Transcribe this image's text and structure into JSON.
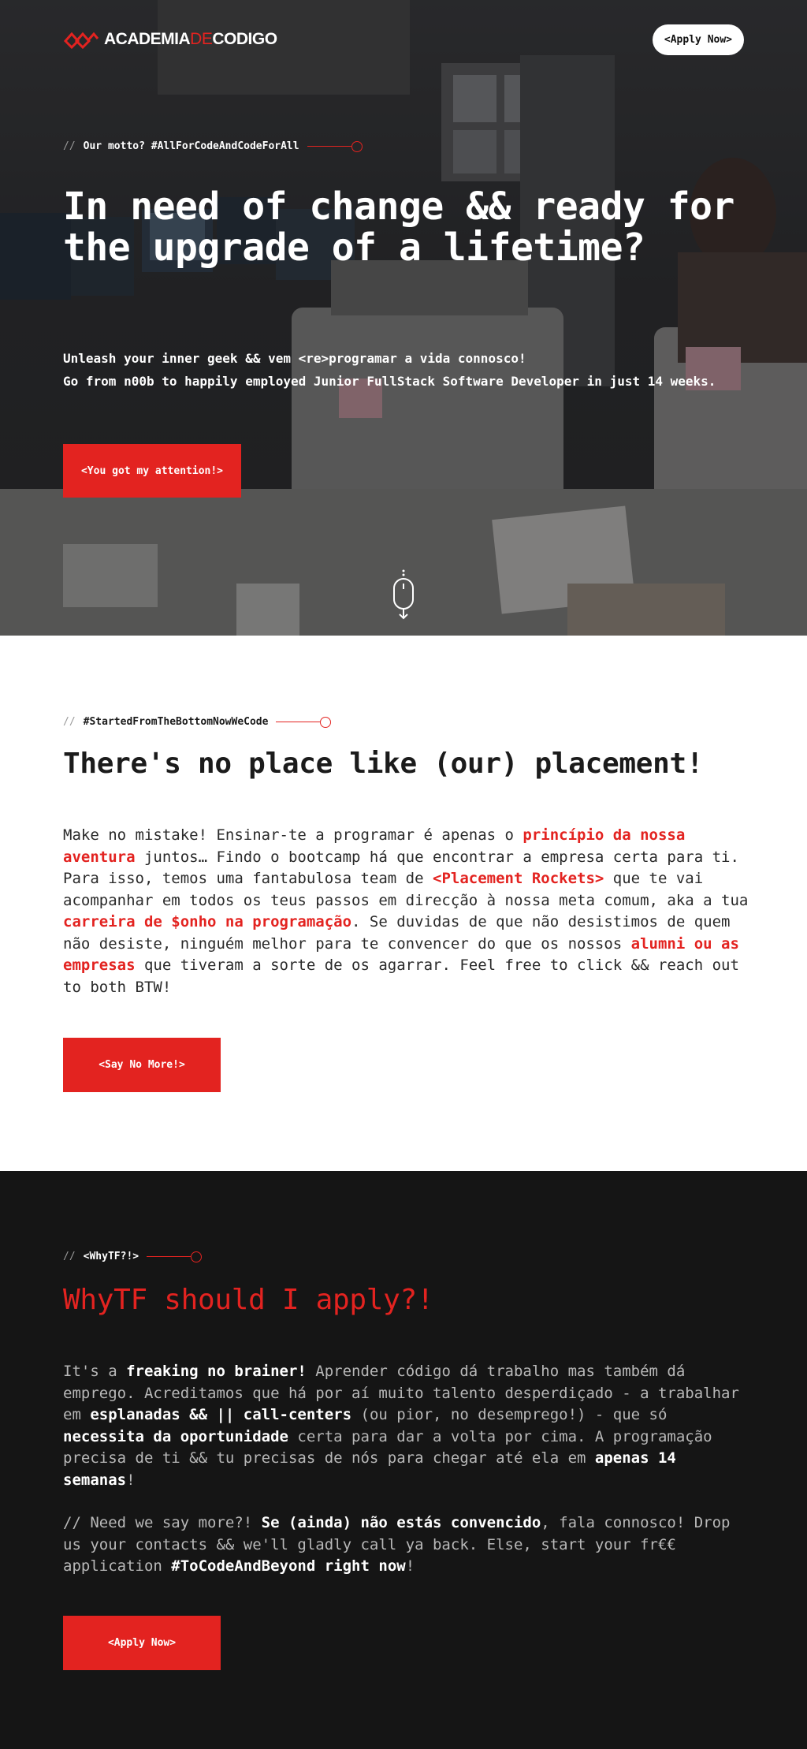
{
  "header": {
    "logo_main": "ACADEMIA",
    "logo_de": "DE",
    "logo_end": "CODIGO",
    "apply_label": "<Apply Now>"
  },
  "hero": {
    "eyebrow_slashes": "//",
    "eyebrow_text": "Our motto? #AllForCodeAndCodeForAll",
    "title": "In need of change && ready for the upgrade of a lifetime?",
    "sub_line1": "Unleash your inner geek && vem <re>programar a vida connosco!",
    "sub_line2": "Go from n00b to happily employed Junior FullStack Software Developer in just 14 weeks.",
    "cta_label": "<You got my attention!>"
  },
  "placement": {
    "eyebrow_slashes": "//",
    "eyebrow_text": "#StartedFromTheBottomNowWeCode",
    "title": "There's no place like (our) placement!",
    "p1": "Make no mistake! Ensinar-te a programar é apenas o ",
    "h1": "princípio da nossa aventura",
    "p2": " juntos… Findo o bootcamp há que encontrar a empresa certa para ti. Para isso, temos uma fantabulosa team de ",
    "h2": "<Placement Rockets>",
    "p3": " que te vai acompanhar em todos os teus passos em direcção à nossa meta comum, aka a tua ",
    "h3": "carreira de $onho na programação",
    "p4": ". Se duvidas de que não desistimos de quem não desiste, ninguém melhor para te convencer do que os nossos ",
    "h4": "alumni ou as empresas",
    "p5": " que tiveram a sorte de os agarrar. Feel free to click && reach out to both BTW!",
    "cta_label": "<Say No More!>"
  },
  "why": {
    "eyebrow_slashes": "//",
    "eyebrow_text": "<WhyTF?!>",
    "title": "WhyTF should I apply?!",
    "a1": "It's a ",
    "b1": "freaking no brainer!",
    "a2": " Aprender código dá trabalho mas também dá emprego. Acreditamos que há por aí muito talento desperdiçado - a trabalhar em ",
    "b2": "esplanadas && || call-centers",
    "a3": " (ou pior, no desemprego!) - que só ",
    "b3": "necessita da oportunidade",
    "a4": " certa para dar a volta por cima. A programação precisa de ti && tu precisas de nós para chegar até ela em ",
    "b4": "apenas 14 semanas",
    "a5": "!",
    "c1": "// Need we say more?! ",
    "d1": "Se (ainda) não estás convencido",
    "c2": ", fala connosco! Drop us your contacts && we'll gladly call ya back. Else, start your fr€€ application ",
    "d2": "#ToCodeAndBeyond right now",
    "c3": "!",
    "cta_label": "<Apply Now>"
  },
  "colors": {
    "accent_red": "#e32320",
    "dark_bg": "#151515",
    "white": "#ffffff"
  },
  "icons": [
    "logo-mark-icon",
    "scroll-mouse-icon",
    "eyebrow-dot-icon"
  ]
}
